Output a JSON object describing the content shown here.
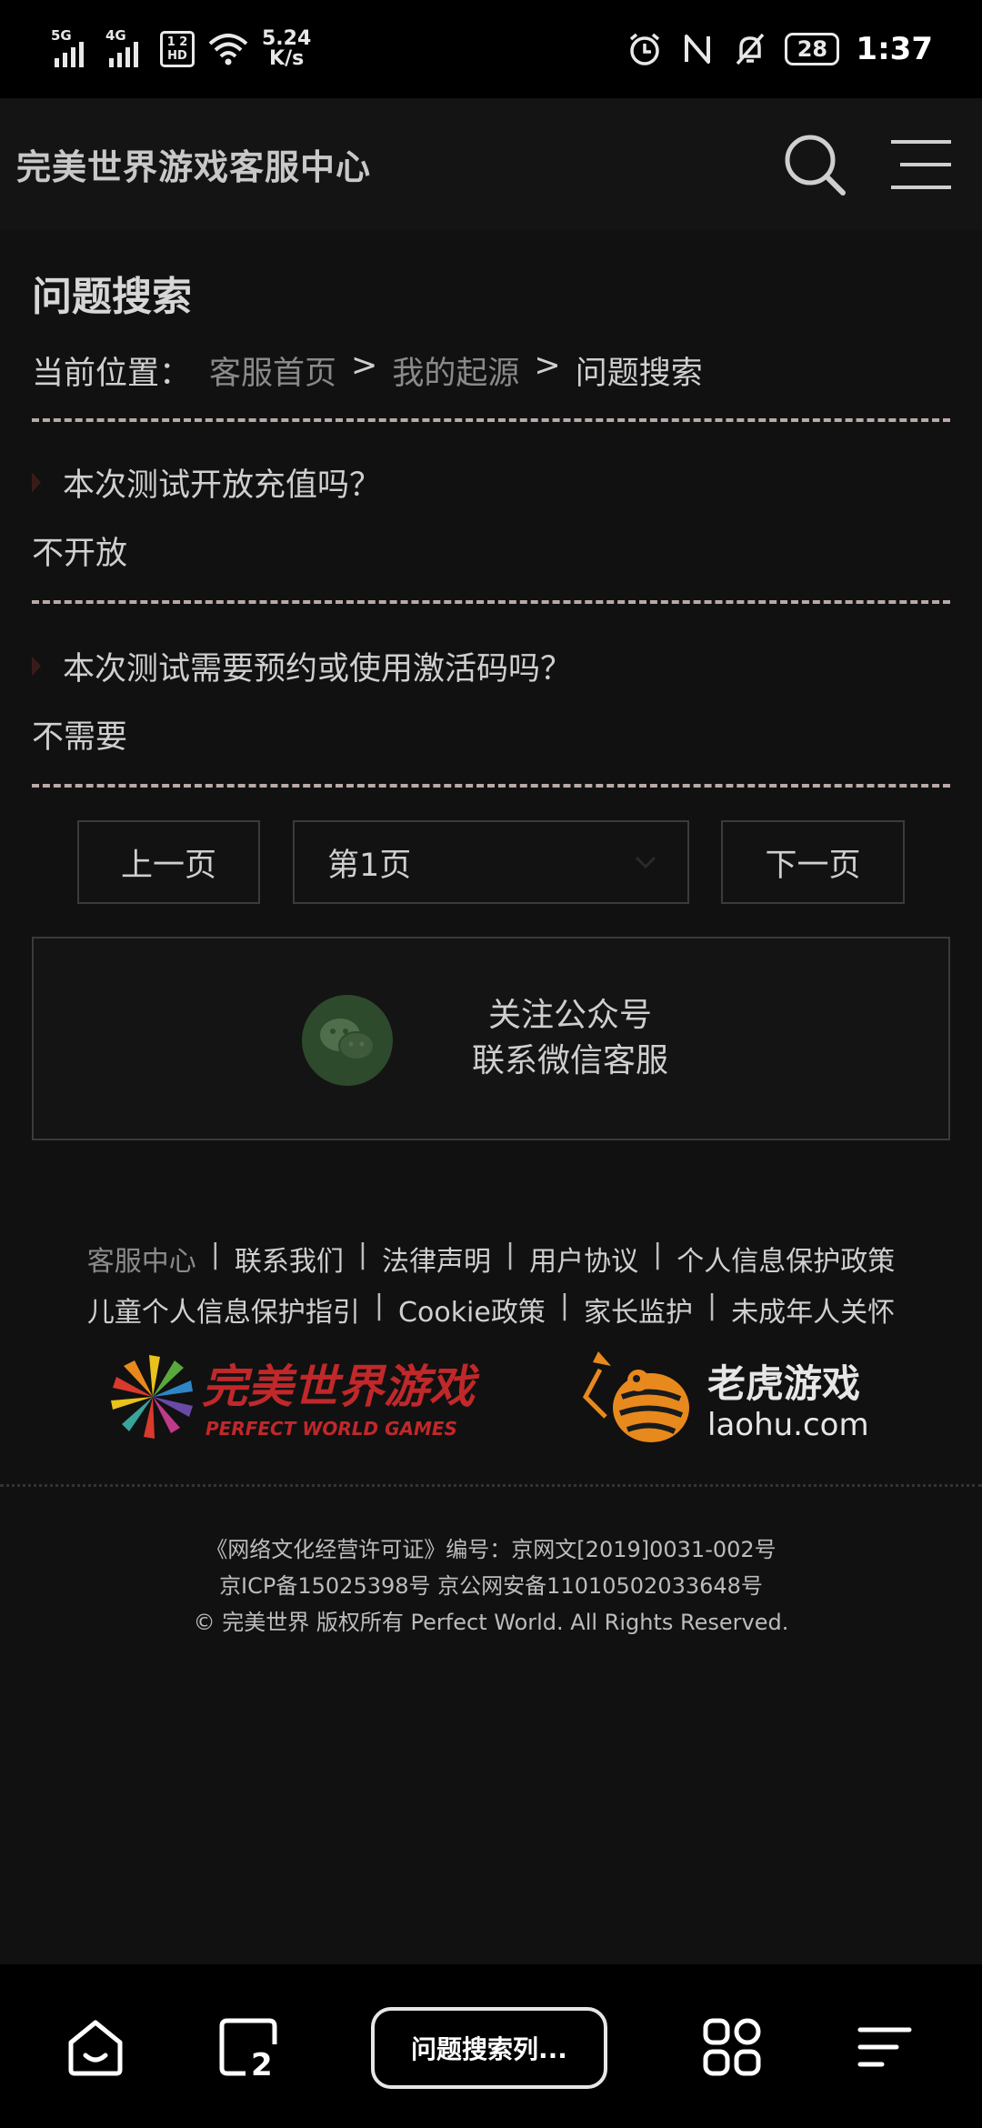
{
  "status_bar": {
    "network_5g": "5G",
    "network_4g": "4G",
    "hd_top": "1 2",
    "hd_bottom": "HD",
    "speed_value": "5.24",
    "speed_unit": "K/s",
    "battery": "28",
    "time": "1:37"
  },
  "header": {
    "title": "完美世界游戏客服中心"
  },
  "page": {
    "heading": "问题搜索",
    "breadcrumb_label": "当前位置：",
    "breadcrumb": [
      "客服首页",
      "我的起源",
      "问题搜索"
    ],
    "breadcrumb_sep": ">"
  },
  "faq": [
    {
      "question": "本次测试开放充值吗？",
      "answer": "不开放"
    },
    {
      "question": "本次测试需要预约或使用激活码吗？",
      "answer": "不需要"
    }
  ],
  "pagination": {
    "prev": "上一页",
    "current": "第1页",
    "next": "下一页"
  },
  "wechat": {
    "line1": "关注公众号",
    "line2": "联系微信客服"
  },
  "footer": {
    "row1": [
      "客服中心",
      "联系我们",
      "法律声明",
      "用户协议",
      "个人信息保护政策"
    ],
    "row2": [
      "儿童个人信息保护指引",
      "Cookie政策",
      "家长监护",
      "未成年人关怀"
    ],
    "sep": "|",
    "logo_pw_cn": "完美世界游戏",
    "logo_pw_en": "PERFECT  WORLD  GAMES",
    "logo_laohu_cn": "老虎游戏",
    "logo_laohu_en": "laohu.com",
    "legal": [
      "《网络文化经营许可证》编号：京网文[2019]0031-002号",
      "京ICP备15025398号 京公网安备11010502033648号",
      "© 完美世界 版权所有    Perfect World. All Rights Reserved."
    ]
  },
  "browser_bar": {
    "tab_count": "2",
    "tab_title": "问题搜索列..."
  },
  "colors": {
    "background": "#111111",
    "dash": "#b9aaa7",
    "logo_red": "#c0282a",
    "logo_orange": "#e8891d"
  }
}
